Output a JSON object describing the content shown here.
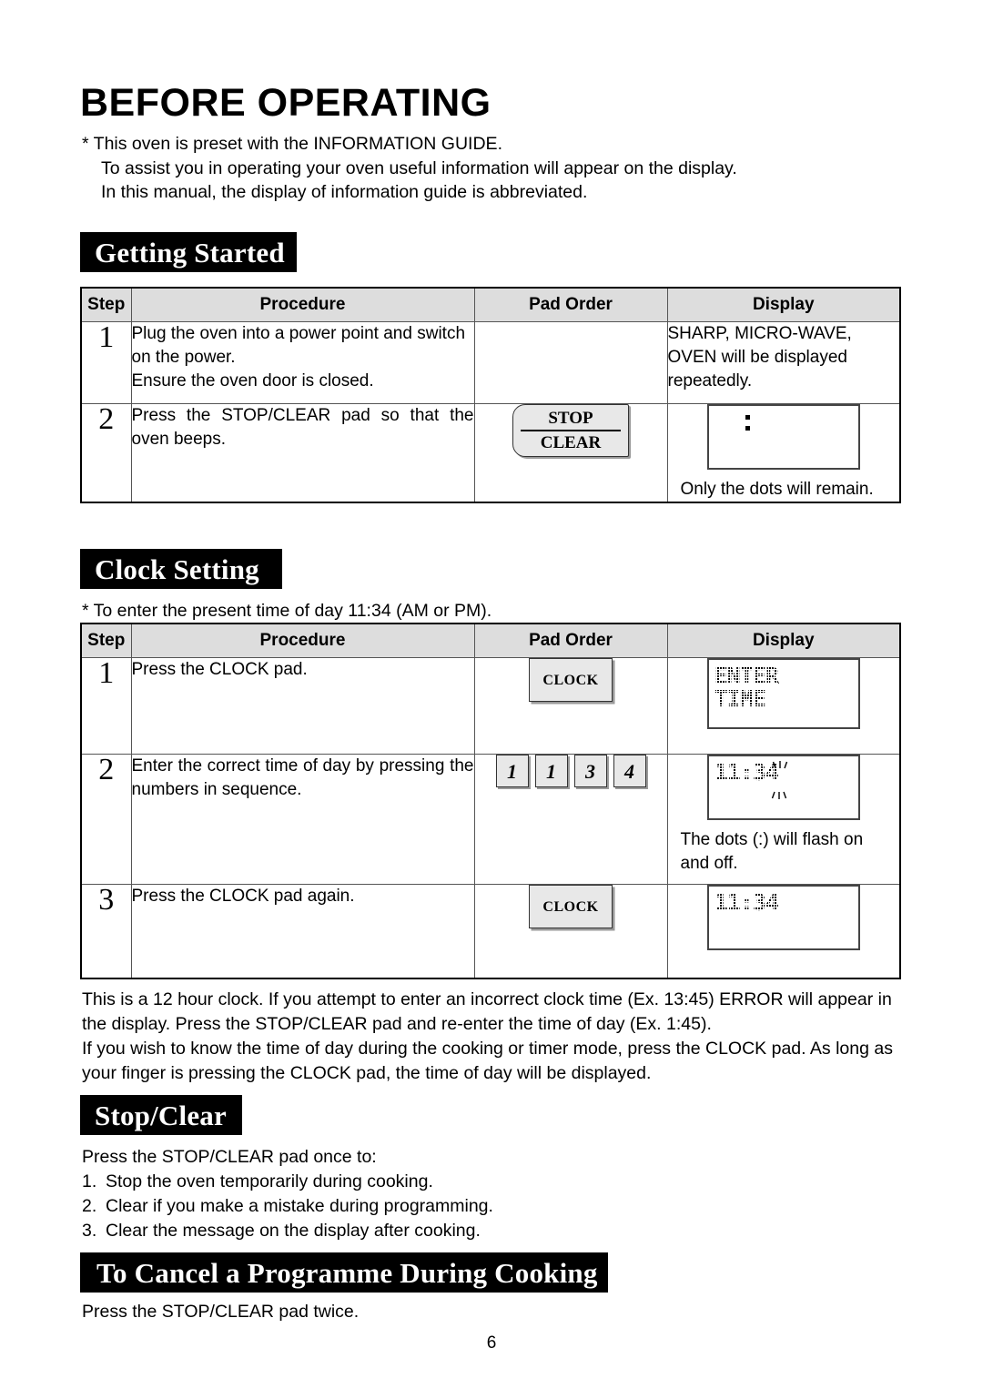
{
  "page": {
    "title": "BEFORE OPERATING",
    "page_number": "6"
  },
  "intro": {
    "line1": "*  This oven is preset with the INFORMATION GUIDE.",
    "line2": "To assist you in operating your oven useful information will appear on the display.",
    "line3": "In this manual, the display of information guide is abbreviated."
  },
  "sections": {
    "getting_started": {
      "heading": "Getting Started",
      "table": {
        "headers": [
          "Step",
          "Procedure",
          "Pad Order",
          "Display"
        ],
        "rows": [
          {
            "step": "1",
            "procedure": "Plug the oven into a power point and switch on the power.\nEnsure the oven door is closed.",
            "procedure_line1": "Plug the oven into a power point and switch on the power.",
            "procedure_line2": "Ensure the oven door is closed.",
            "pad": null,
            "display_text": "SHARP, MICRO-WAVE, OVEN will be displayed repeatedly."
          },
          {
            "step": "2",
            "procedure": "Press the STOP/CLEAR pad so that the oven beeps.",
            "pad": {
              "type": "stop-clear-pad",
              "top_label": "STOP",
              "bottom_label": "CLEAR"
            },
            "display_lcd": {
              "type": "dots-only"
            },
            "display_caption": "Only the dots will remain."
          }
        ]
      }
    },
    "clock_setting": {
      "heading": "Clock Setting",
      "note": "* To enter the present time of day 11:34 (AM or PM).",
      "table": {
        "headers": [
          "Step",
          "Procedure",
          "Pad Order",
          "Display"
        ],
        "rows": [
          {
            "step": "1",
            "procedure": "Press the CLOCK pad.",
            "pad": {
              "type": "clock-pad",
              "label": "CLOCK"
            },
            "display_lcd": {
              "type": "text",
              "line1": "ENTER",
              "line2": "TIME"
            },
            "display_caption": ""
          },
          {
            "step": "2",
            "procedure": "Enter the correct  time of day by pressing the numbers in sequence.",
            "pad": {
              "type": "number-pads",
              "keys": [
                "1",
                "1",
                "3",
                "4"
              ]
            },
            "display_lcd": {
              "type": "time-flashing",
              "line1": "11:34"
            },
            "display_caption": "The dots (:) will flash on and off."
          },
          {
            "step": "3",
            "procedure": "Press the CLOCK pad again.",
            "pad": {
              "type": "clock-pad",
              "label": "CLOCK"
            },
            "display_lcd": {
              "type": "time",
              "line1": "11:34"
            },
            "display_caption": ""
          }
        ]
      },
      "paragraphs": [
        "This is a 12 hour clock. If you attempt to enter an incorrect clock time (Ex. 13:45)  ERROR will appear in the display. Press the STOP/CLEAR pad and re-enter the time of day (Ex. 1:45).",
        "If you wish to know the time of day during the cooking or timer mode, press the CLOCK pad. As long as your finger is pressing the CLOCK pad, the time of day will be displayed."
      ]
    },
    "stop_clear": {
      "heading": "Stop/Clear",
      "intro": "Press the STOP/CLEAR pad once to:",
      "items": [
        {
          "num": "1.",
          "text": "Stop the oven temporarily during cooking."
        },
        {
          "num": "2.",
          "text": "Clear if you make a mistake during programming."
        },
        {
          "num": "3.",
          "text": "Clear the message on the display after cooking."
        }
      ]
    },
    "cancel_programme": {
      "heading": "To Cancel a Programme During Cooking",
      "text": "Press the STOP/CLEAR pad twice."
    }
  }
}
